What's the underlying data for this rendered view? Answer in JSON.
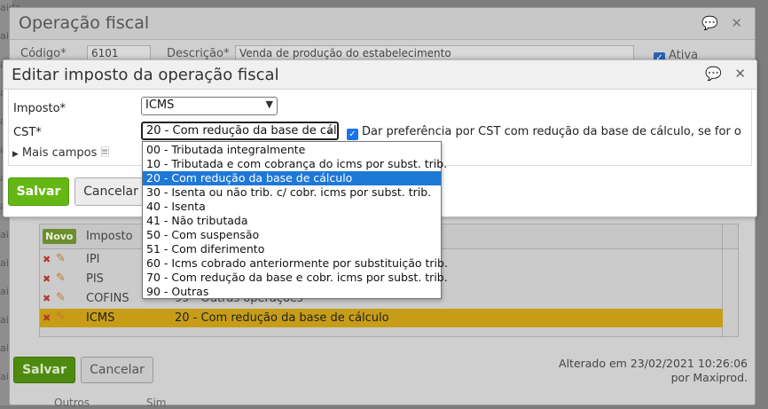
{
  "background_strip": [
    "aida",
    "aida",
    "aida",
    "aida",
    "aida",
    "aida",
    "aida",
    "aida",
    "aida",
    "aida",
    "aida",
    "aida",
    "aida",
    "aida"
  ],
  "outer": {
    "title": "Operação fiscal",
    "codigo_label": "Código*",
    "codigo_value": "6101",
    "descricao_label": "Descrição*",
    "descricao_value": "Venda de produção do estabelecimento",
    "ativa_label": "Ativa",
    "table": {
      "novo_label": "Novo",
      "header_imposto": "Imposto",
      "rows": [
        {
          "imposto": "IPI",
          "cst": ""
        },
        {
          "imposto": "PIS",
          "cst": ""
        },
        {
          "imposto": "COFINS",
          "cst": "99 - Outras operações"
        },
        {
          "imposto": "ICMS",
          "cst": "20 - Com redução da base de cálculo"
        }
      ]
    },
    "save_label": "Salvar",
    "cancel_label": "Cancelar",
    "altered_line1": "Alterado em 23/02/2021 10:26:06",
    "altered_line2": "por Maxiprod.",
    "bottom_col1": "Outros",
    "bottom_col2": "Sim"
  },
  "inner": {
    "title": "Editar imposto da operação fiscal",
    "imposto_label": "Imposto*",
    "imposto_value": "ICMS",
    "cst_label": "CST*",
    "cst_value": "20 - Com redução da base de cál",
    "pref_label": "Dar preferência por CST com redução da base de cálculo, se for o caso",
    "mais_campos": "Mais campos",
    "save_label": "Salvar",
    "cancel_label": "Cancelar",
    "cst_options": [
      "00 - Tributada integralmente",
      "10 - Tributada e com cobrança do icms por subst. trib.",
      "20 - Com redução da base de cálculo",
      "30 - Isenta ou não trib. c/ cobr. icms por subst. trib.",
      "40 - Isenta",
      "41 - Não tributada",
      "50 - Com suspensão",
      "51 - Com diferimento",
      "60 - Icms cobrado anteriormente por substituição trib.",
      "70 - Com redução da base e cobr. icms por subst. trib.",
      "90 - Outras"
    ],
    "highlighted_index": 2
  },
  "colors": {
    "save_green": "#65b814",
    "highlight_blue": "#1e78d6",
    "selected_row": "#c79d17"
  }
}
